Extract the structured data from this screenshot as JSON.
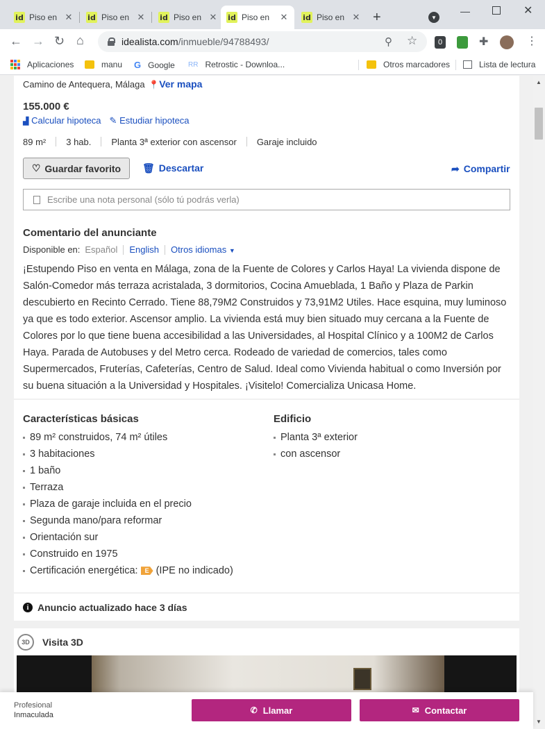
{
  "browser": {
    "tabs": [
      {
        "favicon": "id",
        "label": "Piso en",
        "close": "✕"
      },
      {
        "favicon": "id",
        "label": "Piso en",
        "close": "✕"
      },
      {
        "favicon": "id",
        "label": "Piso en",
        "close": "✕"
      },
      {
        "favicon": "id",
        "label": "Piso en",
        "close": "✕"
      },
      {
        "favicon": "id",
        "label": "Piso en",
        "close": "✕"
      }
    ],
    "active_tab": 3,
    "url_host": "idealista.com",
    "url_path": "/inmueble/94788493/",
    "bookmarks": {
      "apps": "Aplicaciones",
      "manu": "manu",
      "google": "Google",
      "retrostic": "Retrostic - Downloa...",
      "otros": "Otros marcadores",
      "lectura": "Lista de lectura"
    },
    "extension_badge": "0"
  },
  "listing": {
    "address": "Camino de Antequera, Málaga",
    "map_link": "Ver mapa",
    "price": "155.000 €",
    "calc_mortgage": "Calcular hipoteca",
    "study_mortgage": "Estudiar hipoteca",
    "features": [
      "89 m²",
      "3 hab.",
      "Planta 3ª exterior con ascensor",
      "Garaje incluido"
    ],
    "save_button": "Guardar favorito",
    "discard_button": "Descartar",
    "share_button": "Compartir",
    "note_placeholder": "Escribe una nota personal (sólo tú podrás verla)"
  },
  "comment": {
    "title": "Comentario del anunciante",
    "available_in": "Disponible en:",
    "lang_es": "Español",
    "lang_en": "English",
    "lang_other": "Otros idiomas",
    "text": "¡Estupendo Piso en venta en Málaga, zona de la Fuente de Colores y Carlos Haya! La vivienda dispone de Salón-Comedor más terraza acristalada, 3 dormitorios, Cocina Amueblada, 1 Baño y Plaza de Parkin descubierto en Recinto Cerrado. Tiene 88,79M2 Construidos y 73,91M2 Utiles. Hace esquina, muy luminoso ya que es todo exterior. Ascensor amplio. La vivienda está muy bien situado muy cercana a la Fuente de Colores por lo que tiene buena accesibilidad a las Universidades, al Hospital Clínico y a 100M2 de Carlos Haya. Parada de Autobuses y del Metro cerca. Rodeado de variedad de comercios, tales como Supermercados, Fruterías, Cafeterías, Centro de Salud. Ideal como Vivienda habitual o como Inversión por su buena situación a la Universidad y Hospitales. ¡Visitelo! Comercializa Unicasa Home."
  },
  "basic": {
    "title": "Características básicas",
    "items": [
      "89 m² construidos, 74 m² útiles",
      "3 habitaciones",
      "1 baño",
      "Terraza",
      "Plaza de garaje incluida en el precio",
      "Segunda mano/para reformar",
      "Orientación sur",
      "Construido en 1975"
    ],
    "energy_label": "Certificación energética:",
    "energy_badge": "E",
    "energy_note": "(IPE no indicado)"
  },
  "building": {
    "title": "Edificio",
    "items": [
      "Planta 3ª exterior",
      "con ascensor"
    ]
  },
  "updated": "Anuncio actualizado hace 3 días",
  "visit3d": {
    "badge": "3D",
    "title": "Visita 3D"
  },
  "footer": {
    "profile_type": "Profesional",
    "agency": "Inmaculada",
    "call": "Llamar",
    "contact": "Contactar"
  },
  "colors": {
    "brand_link": "#1a4fbf",
    "cta": "#b3267f",
    "favicon": "#e1f25b"
  }
}
